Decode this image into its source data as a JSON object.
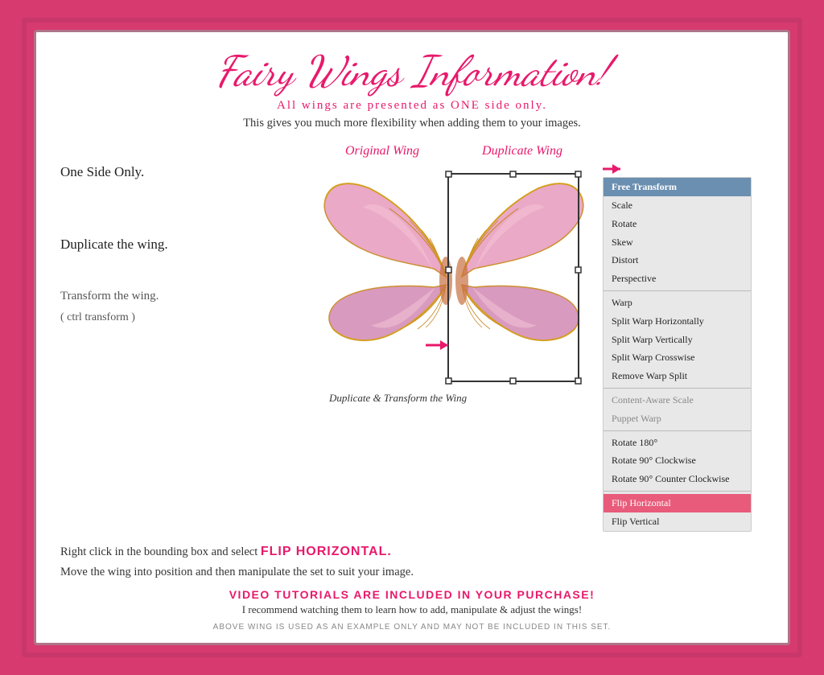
{
  "page": {
    "background": "#d63a6e"
  },
  "title": "Fairy Wings Information!",
  "subtitle1": "All wings are presented as ONE side only.",
  "subtitle2": "This gives you much more flexibility when adding them to your images.",
  "labels": {
    "one_side": "One Side Only.",
    "duplicate": "Duplicate the wing.",
    "transform": "Transform the wing.",
    "transform_sub": "( ctrl transform )",
    "original_wing": "Original Wing",
    "duplicate_wing": "Duplicate Wing",
    "dup_transform": "Duplicate & Transform the Wing"
  },
  "flip_line": {
    "before": "Right click in the bounding box and select",
    "highlight": "FLIP HORIZONTAL."
  },
  "move_line": "Move the wing into position and then manipulate the set to suit your image.",
  "video_line": "VIDEO TUTORIALS ARE INCLUDED IN YOUR PURCHASE!",
  "recommend_line": "I recommend watching them to learn how to add, manipulate & adjust the wings!",
  "footer": "ABOVE WING IS USED AS AN EXAMPLE ONLY AND MAY NOT BE INCLUDED IN THIS SET.",
  "menu": {
    "items": [
      {
        "label": "Free Transform",
        "state": "selected"
      },
      {
        "label": "Scale",
        "state": "normal"
      },
      {
        "label": "Rotate",
        "state": "normal"
      },
      {
        "label": "Skew",
        "state": "normal"
      },
      {
        "label": "Distort",
        "state": "normal"
      },
      {
        "label": "Perspective",
        "state": "normal"
      },
      {
        "label": "---"
      },
      {
        "label": "Warp",
        "state": "normal"
      },
      {
        "label": "Split Warp Horizontally",
        "state": "normal"
      },
      {
        "label": "Split Warp Vertically",
        "state": "normal"
      },
      {
        "label": "Split Warp Crosswise",
        "state": "normal"
      },
      {
        "label": "Remove Warp Split",
        "state": "normal"
      },
      {
        "label": "---"
      },
      {
        "label": "Content-Aware Scale",
        "state": "normal"
      },
      {
        "label": "Puppet Warp",
        "state": "normal"
      },
      {
        "label": "---"
      },
      {
        "label": "Rotate 180°",
        "state": "normal"
      },
      {
        "label": "Rotate 90° Clockwise",
        "state": "normal"
      },
      {
        "label": "Rotate 90° Counter Clockwise",
        "state": "normal"
      },
      {
        "label": "---"
      },
      {
        "label": "Flip Horizontal",
        "state": "highlighted"
      },
      {
        "label": "Flip Vertical",
        "state": "normal"
      }
    ]
  }
}
